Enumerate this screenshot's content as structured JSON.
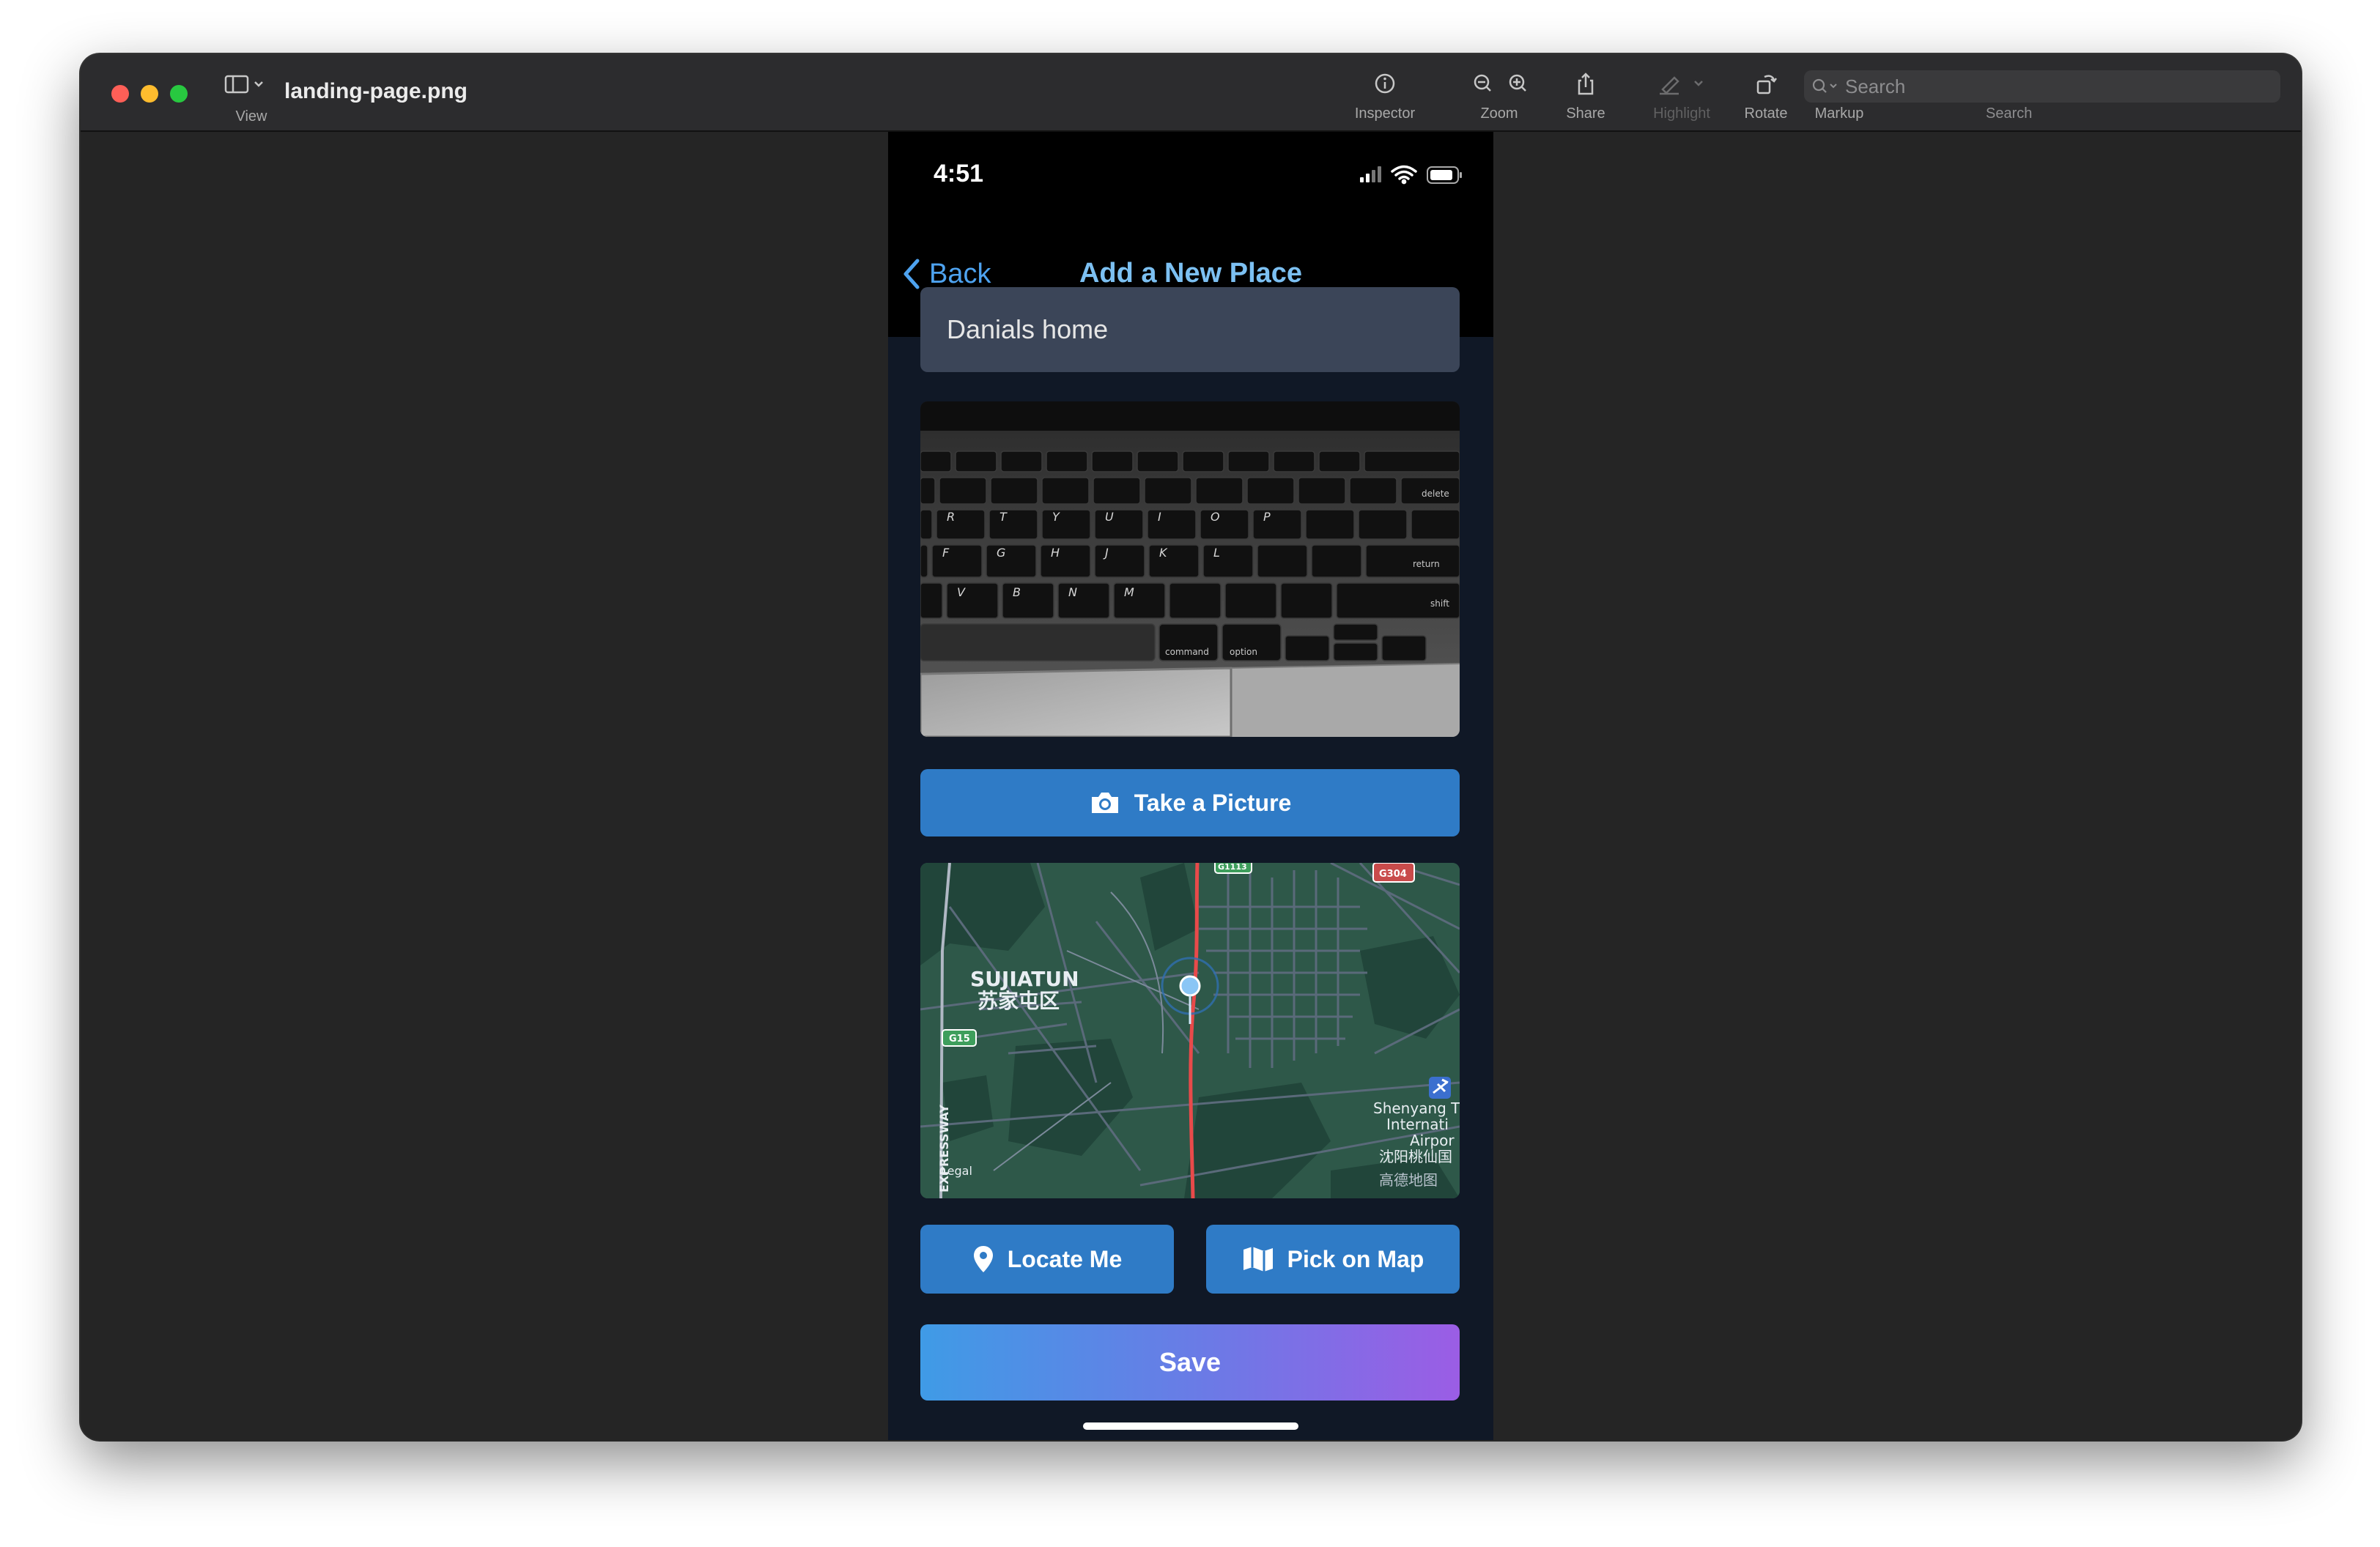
{
  "window": {
    "file_name": "landing-page.png",
    "view_label": "View",
    "toolbar": {
      "inspector": "Inspector",
      "zoom": "Zoom",
      "share": "Share",
      "highlight": "Highlight",
      "rotate": "Rotate",
      "markup": "Markup",
      "search_placeholder": "Search",
      "search_caption": "Search"
    },
    "traffic_light_colors": [
      "#fe5f57",
      "#febc2e",
      "#28c840"
    ]
  },
  "phone": {
    "status": {
      "time": "4:51"
    },
    "nav": {
      "back_label": "Back",
      "title": "Add a New Place"
    },
    "place_name_value": "Danials home",
    "photo_alt": "keyboard",
    "buttons": {
      "take_picture": "Take a Picture",
      "locate_me": "Locate Me",
      "pick_on_map": "Pick on Map",
      "save": "Save"
    },
    "map": {
      "district_en": "SUJIATUN",
      "district_zh": "苏家屯区",
      "route_g15": "G15",
      "route_g304": "G304",
      "route_top": "G1113",
      "expressway": "EXPRESSWAY",
      "airport_lines": [
        "Shenyang T",
        "Internati",
        "Airpor",
        "沈阳桃仙国"
      ],
      "legal": "Legal",
      "provider": "高德地图"
    },
    "keyboard_keys": {
      "row1": [
        "R",
        "T",
        "Y",
        "U",
        "I",
        "O",
        "P"
      ],
      "row2": [
        "F",
        "G",
        "H",
        "J",
        "K",
        "L"
      ],
      "row3": [
        "V",
        "B",
        "N",
        "M"
      ],
      "mods": [
        "command",
        "option",
        "return",
        "delete",
        "shift"
      ]
    },
    "colors": {
      "accent_blue": "#2f7bc6",
      "link_blue": "#4ea3f0",
      "input_bg": "#3b4558",
      "save_gradient_start": "#3f9be6",
      "save_gradient_end": "#9b5de5"
    }
  }
}
